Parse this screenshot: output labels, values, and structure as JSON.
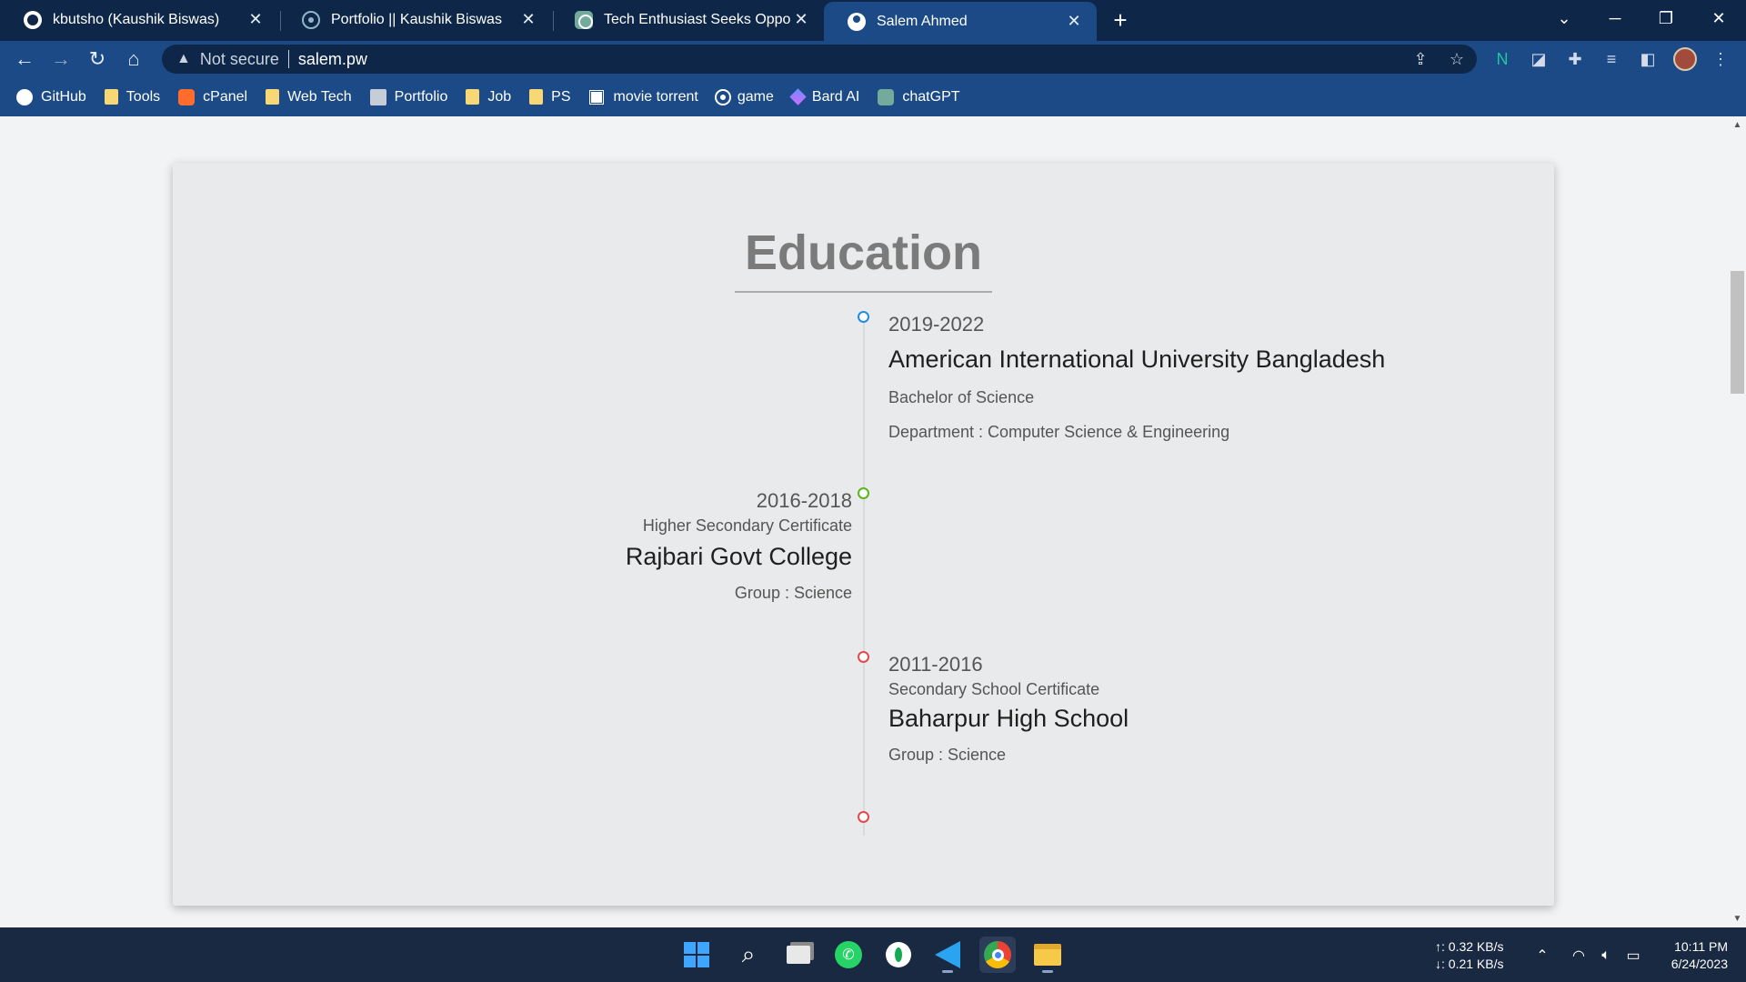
{
  "tabs": [
    {
      "title": "kbutsho (Kaushik Biswas)",
      "icon": "github-icon",
      "active": false
    },
    {
      "title": "Portfolio || Kaushik Biswas",
      "icon": "react-icon",
      "active": false
    },
    {
      "title": "Tech Enthusiast Seeks Opportuni",
      "icon": "chatgpt-icon",
      "active": false
    },
    {
      "title": "Salem Ahmed",
      "icon": "user-icon",
      "active": true
    }
  ],
  "toolbar": {
    "security_label": "Not secure",
    "url": "salem.pw"
  },
  "bookmarks": [
    {
      "label": "GitHub",
      "icon": "github-icon"
    },
    {
      "label": "Tools",
      "icon": "folder-icon"
    },
    {
      "label": "cPanel",
      "icon": "cpanel-icon"
    },
    {
      "label": "Web Tech",
      "icon": "folder-icon"
    },
    {
      "label": "Portfolio",
      "icon": "portfolio-icon"
    },
    {
      "label": "Job",
      "icon": "folder-icon"
    },
    {
      "label": "PS",
      "icon": "folder-icon"
    },
    {
      "label": "movie torrent",
      "icon": "movie-icon"
    },
    {
      "label": "game",
      "icon": "game-icon"
    },
    {
      "label": "Bard AI",
      "icon": "bard-icon"
    },
    {
      "label": "chatGPT",
      "icon": "chatgpt-icon"
    }
  ],
  "page": {
    "heading": "Education",
    "entries": [
      {
        "years": "2019-2022",
        "school": "American International University Bangladesh",
        "degree": "Bachelor of Science",
        "detail": "Department : Computer Science & Engineering",
        "dot_color": "#1e8ee0"
      },
      {
        "years": "2016-2018",
        "degree": "Higher Secondary Certificate",
        "school": "Rajbari Govt College",
        "detail": "Group : Science",
        "dot_color": "#5bb51c"
      },
      {
        "years": "2011-2016",
        "degree": "Secondary School Certificate",
        "school": "Baharpur High School",
        "detail": "Group : Science",
        "dot_color": "#e5484d"
      }
    ],
    "end_dot_color": "#e5484d"
  },
  "taskbar": {
    "apps": [
      "start-icon",
      "search-icon",
      "task-view-icon",
      "whatsapp-icon",
      "mongodb-compass-icon",
      "vscode-icon",
      "chrome-icon",
      "file-explorer-icon"
    ],
    "net_up": "↑: 0.32 KB/s",
    "net_down": "↓: 0.21 KB/s",
    "time": "10:11 PM",
    "date": "6/24/2023"
  },
  "colors": {
    "tab_strip": "#0e2749",
    "toolbar": "#1b4a86",
    "page_bg": "#f1f3f4",
    "card_bg": "#e8eaeb",
    "taskbar": "#1a2942"
  }
}
